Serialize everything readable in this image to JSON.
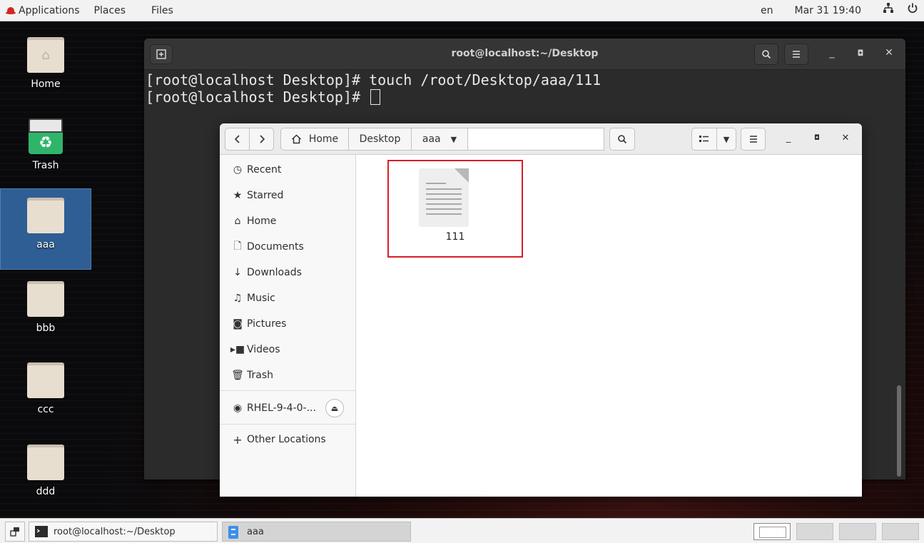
{
  "topbar": {
    "applications": "Applications",
    "places": "Places",
    "files": "Files",
    "lang": "en",
    "datetime": "Mar 31  19:40"
  },
  "desktop": {
    "icons": [
      {
        "label": "Home"
      },
      {
        "label": "Trash"
      },
      {
        "label": "aaa"
      },
      {
        "label": "bbb"
      },
      {
        "label": "ccc"
      },
      {
        "label": "ddd"
      }
    ]
  },
  "terminal": {
    "title": "root@localhost:~/Desktop",
    "line1": "[root@localhost Desktop]# touch /root/Desktop/aaa/111",
    "line2": "[root@localhost Desktop]# "
  },
  "files": {
    "breadcrumbs": [
      "Home",
      "Desktop",
      "aaa"
    ],
    "sidebar": [
      {
        "label": "Recent",
        "icon": "clock-icon"
      },
      {
        "label": "Starred",
        "icon": "star-icon"
      },
      {
        "label": "Home",
        "icon": "home-icon"
      },
      {
        "label": "Documents",
        "icon": "document-icon"
      },
      {
        "label": "Downloads",
        "icon": "download-icon"
      },
      {
        "label": "Music",
        "icon": "music-icon"
      },
      {
        "label": "Pictures",
        "icon": "camera-icon"
      },
      {
        "label": "Videos",
        "icon": "video-icon"
      },
      {
        "label": "Trash",
        "icon": "trash-icon"
      }
    ],
    "drive": {
      "label": "RHEL-9-4-0-..."
    },
    "other": {
      "label": "Other Locations"
    },
    "items": [
      {
        "name": "111"
      }
    ]
  },
  "taskbar": {
    "tasks": [
      {
        "label": "root@localhost:~/Desktop"
      },
      {
        "label": "aaa"
      }
    ]
  }
}
